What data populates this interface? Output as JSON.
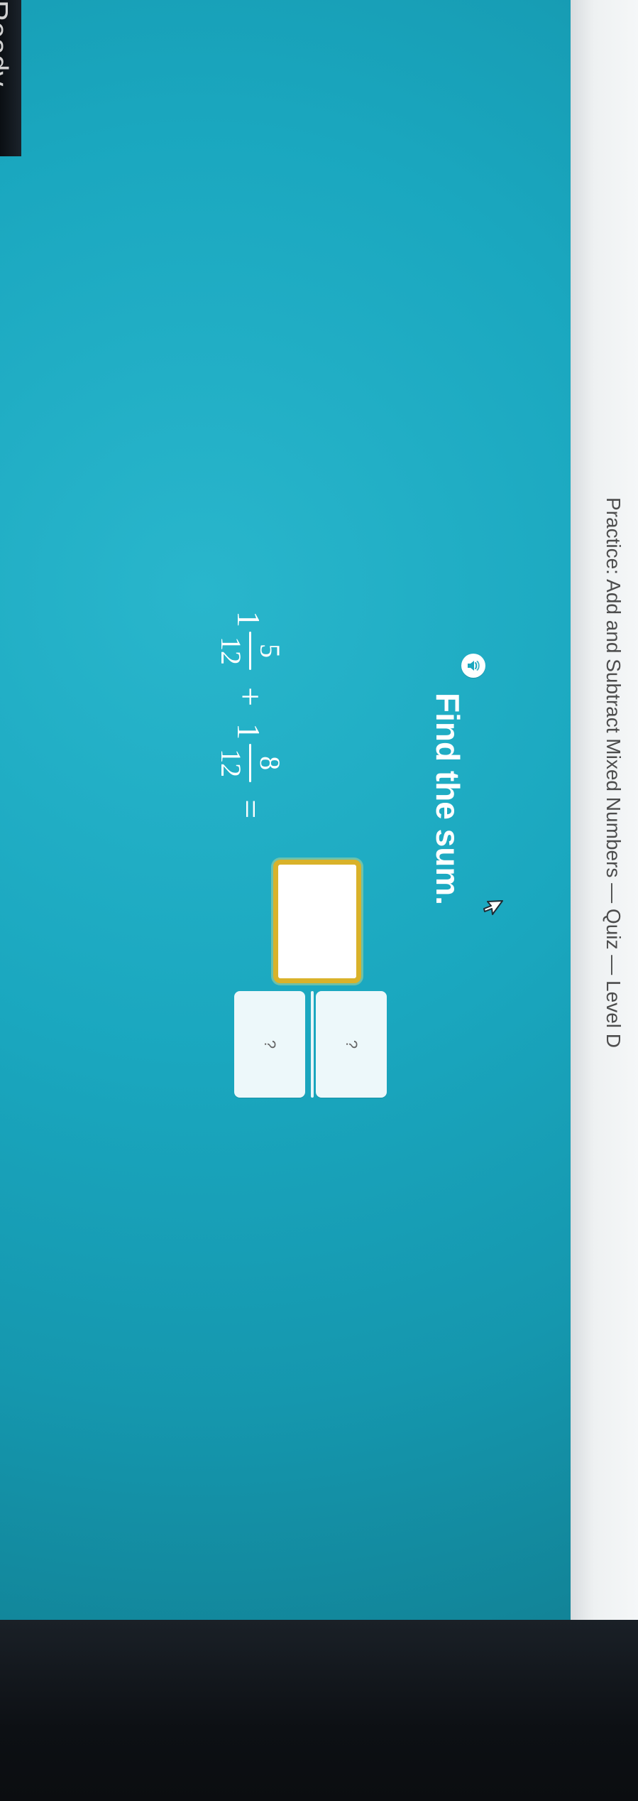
{
  "status": {
    "ready_label": "Ready"
  },
  "window": {
    "title": "Practice: Add and Subtract Mixed Numbers — Quiz — Level D",
    "close_label": "×"
  },
  "question": {
    "prompt": "Find the sum.",
    "equation": {
      "left": {
        "whole": "1",
        "numerator": "5",
        "denominator": "12"
      },
      "operator": "+",
      "right": {
        "whole": "1",
        "numerator": "8",
        "denominator": "12"
      },
      "equals": "="
    },
    "answer": {
      "whole_placeholder": "",
      "numerator_placeholder": "?",
      "denominator_placeholder": "?"
    }
  },
  "icons": {
    "speaker": "speaker-icon",
    "cursor": "cursor-icon",
    "close": "close-icon"
  },
  "colors": {
    "screen_teal": "#1aa7bf",
    "focus_yellow": "#d9b22a",
    "text_white": "#ffffff",
    "title_gray": "#4d4d4d"
  }
}
